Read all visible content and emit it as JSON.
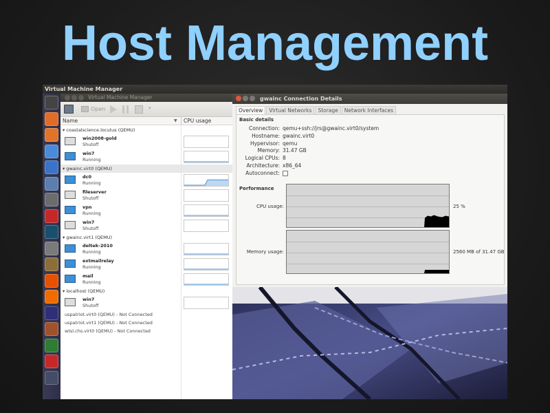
{
  "slide": {
    "title": "Host Management"
  },
  "top_panel": {
    "title": "Virtual Machine Manager"
  },
  "vmm": {
    "window_title": "Virtual Machine Manager",
    "toolbar": {
      "open_label": "Open"
    },
    "columns": {
      "name": "Name",
      "cpu": "CPU usage"
    },
    "groups": [
      {
        "label": "coastalscience.locutus (QEMU)",
        "vms": [
          {
            "name": "win2008-gold",
            "state": "Shutoff",
            "running": false,
            "cpu_level": 0
          },
          {
            "name": "win7",
            "state": "Running",
            "running": true,
            "cpu_level": 0.05
          }
        ]
      },
      {
        "label": "gwainc.virt0 (QEMU)",
        "selected": true,
        "vms": [
          {
            "name": "dc0",
            "state": "Running",
            "running": true,
            "cpu_level": 0.55
          },
          {
            "name": "fileserver",
            "state": "Shutoff",
            "running": false,
            "cpu_level": 0
          },
          {
            "name": "vpn",
            "state": "Running",
            "running": true,
            "cpu_level": 0.05
          },
          {
            "name": "win7",
            "state": "Shutoff",
            "running": false,
            "cpu_level": 0
          }
        ]
      },
      {
        "label": "gwainc.virt1 (QEMU)",
        "vms": [
          {
            "name": "deltek-2010",
            "state": "Running",
            "running": true,
            "cpu_level": 0.05
          },
          {
            "name": "extmailrelay",
            "state": "Running",
            "running": true,
            "cpu_level": 0.05
          },
          {
            "name": "mail",
            "state": "Running",
            "running": true,
            "cpu_level": 0.05
          }
        ]
      },
      {
        "label": "localhost (QEMU)",
        "vms": [
          {
            "name": "win7",
            "state": "Shutoff",
            "running": false,
            "cpu_level": 0
          }
        ]
      }
    ],
    "disconnected": [
      "uspatriot.virt0 (QEMU) - Not Connected",
      "uspatriot.virt1 (QEMU) - Not Connected",
      "wtsl.chs.virt0 (QEMU) - Not Connected"
    ]
  },
  "details": {
    "window_title": "gwainc Connection Details",
    "tabs": [
      "Overview",
      "Virtual Networks",
      "Storage",
      "Network Interfaces"
    ],
    "active_tab": 0,
    "basic_heading": "Basic details",
    "fields": [
      {
        "label": "Connection:",
        "value": "qemu+ssh://jrs@gwainc.virt0/system"
      },
      {
        "label": "Hostname:",
        "value": "gwainc.virt0"
      },
      {
        "label": "Hypervisor:",
        "value": "qemu"
      },
      {
        "label": "Memory:",
        "value": "31.47 GB"
      },
      {
        "label": "Logical CPUs:",
        "value": "8"
      },
      {
        "label": "Architecture:",
        "value": "x86_64"
      },
      {
        "label": "Autoconnect:",
        "value": ""
      }
    ],
    "autoconnect_checked": false,
    "performance_heading": "Performance",
    "cpu": {
      "label": "CPU usage:",
      "value_text": "25 %",
      "level": 0.25
    },
    "memory": {
      "label": "Memory usage:",
      "value_text": "2560 MB of 31.47 GB",
      "level": 0.08
    }
  },
  "colors": {
    "title": "#8fd0ff",
    "launcher": "#2e2f48",
    "cpu_line": "#4a90d9"
  },
  "icons": [
    "dash-home-icon",
    "files-icon",
    "firefox-icon",
    "chrome-icon",
    "chat-icon",
    "monitor-icon",
    "system-monitor-icon",
    "terminal-icon",
    "globe-icon",
    "calculator-icon",
    "gimp-icon",
    "software-center-icon",
    "text-editor-icon",
    "inkscape-icon",
    "image-viewer-icon",
    "sketch-icon",
    "download-icon",
    "workspace-icon"
  ]
}
